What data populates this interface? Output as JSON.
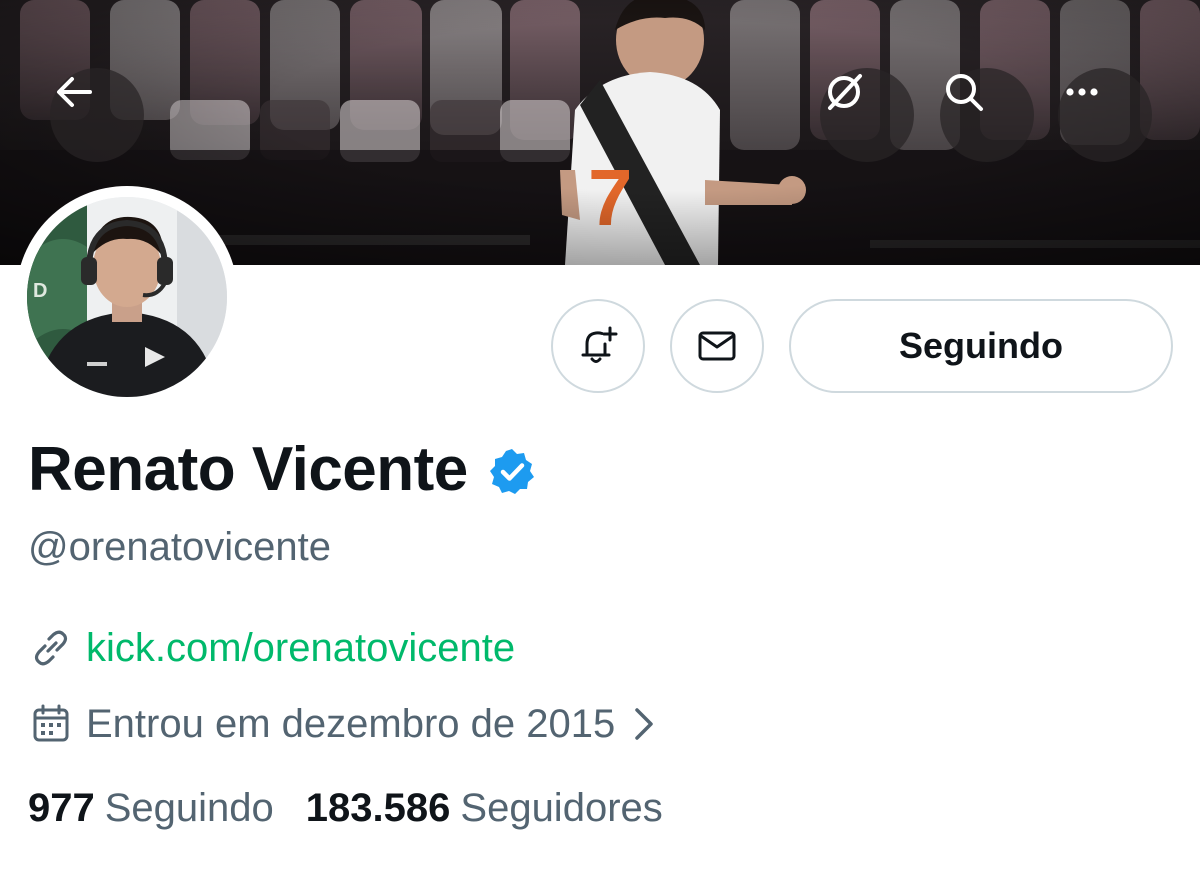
{
  "banner": {
    "description_icon": "banner-photo"
  },
  "top_bar": {
    "back_icon": "arrow-left-icon",
    "grok_icon": "grok-icon",
    "search_icon": "search-icon",
    "more_icon": "more-horizontal-icon"
  },
  "profile": {
    "display_name": "Renato Vicente",
    "verified": true,
    "verified_color": "#1d9bf0",
    "handle": "@orenatovicente",
    "link": "kick.com/orenatovicente",
    "link_color": "#00b96b",
    "joined": "Entrou em dezembro de 2015"
  },
  "actions": {
    "notify_icon": "bell-plus-icon",
    "message_icon": "envelope-icon",
    "follow_label": "Seguindo"
  },
  "stats": {
    "following_count": "977",
    "following_label": "Seguindo",
    "followers_count": "183.586",
    "followers_label": "Seguidores"
  },
  "colors": {
    "text_primary": "#0f1419",
    "text_secondary": "#536471",
    "border": "#cfd9de"
  }
}
